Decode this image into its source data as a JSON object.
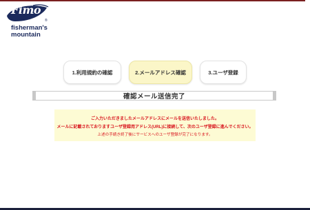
{
  "header": {
    "logo_script": "Fimo",
    "logo_line1": "fisherman's",
    "logo_line2": "mountain",
    "logo_registered": "®"
  },
  "steps": [
    {
      "label": "1.利用規約の確認",
      "active": false
    },
    {
      "label": "2.メールアドレス確認",
      "active": true
    },
    {
      "label": "3.ユーザ登録",
      "active": false
    }
  ],
  "page_title": "確認メール送信完了",
  "notice": {
    "line1": "ご入力いただきましたメールアドレスにメールを送信いたしました。",
    "line2": "メールに記載されておりますユーザ登録用アドレス(URL)に接続して、次のユーザ登録に進んでください。",
    "line3": "上述の手続き終了後にサービスへのユーザ登録が完了になります。"
  },
  "colors": {
    "brand_navy": "#1b2a5c",
    "active_step_bg": "#fbf6c8",
    "notice_bg": "#fdfbd4",
    "notice_text": "#d8131c",
    "top_bar": "#7a1f1f"
  }
}
